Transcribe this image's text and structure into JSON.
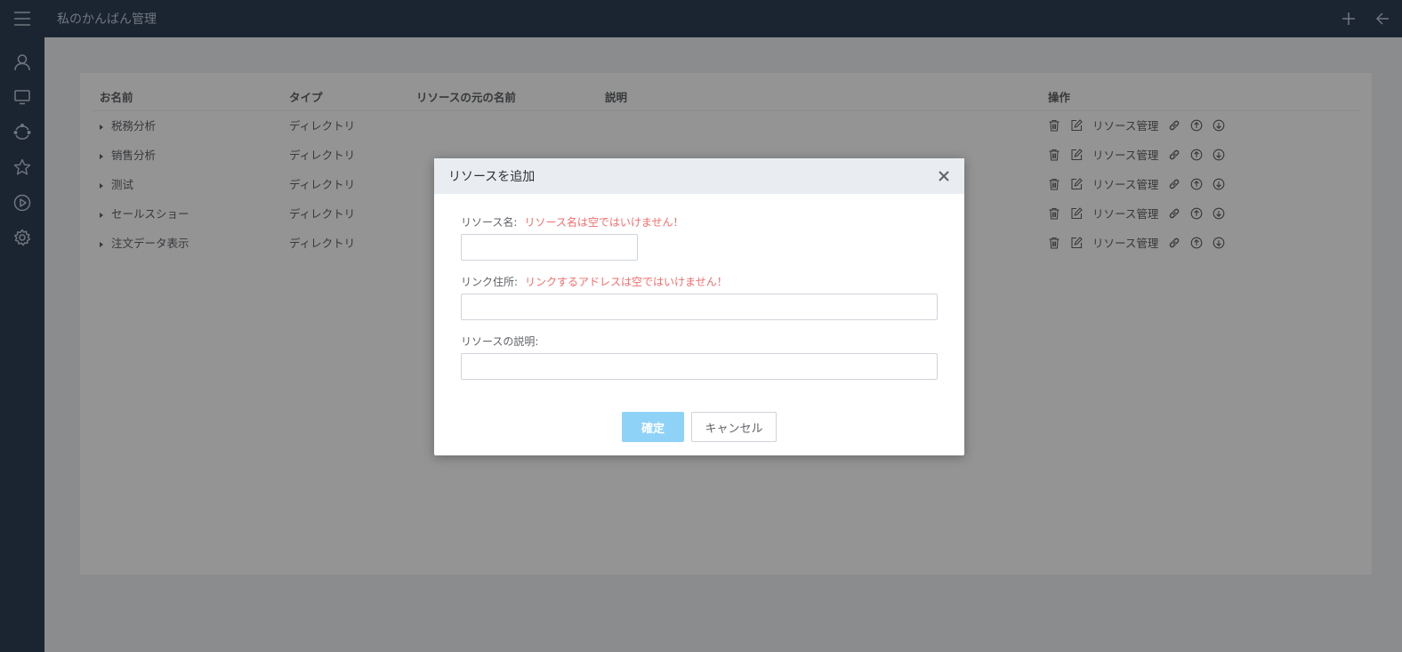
{
  "header": {
    "title": "私のかんばん管理"
  },
  "colors": {
    "sidebar_bg": "#304156",
    "error": "#f56c6c",
    "primary_disabled": "#8fd2f7"
  },
  "sidebar": {
    "icons": [
      "user-icon",
      "monitor-icon",
      "refresh-icon",
      "star-icon",
      "play-icon",
      "settings-icon"
    ]
  },
  "table": {
    "columns": [
      "お名前",
      "タイプ",
      "リソースの元の名前",
      "説明",
      "操作"
    ],
    "rows": [
      {
        "name": "税務分析",
        "type": "ディレクトリ",
        "source": "",
        "desc": "",
        "manage": "リソース管理"
      },
      {
        "name": "销售分析",
        "type": "ディレクトリ",
        "source": "",
        "desc": "",
        "manage": "リソース管理"
      },
      {
        "name": "测试",
        "type": "ディレクトリ",
        "source": "",
        "desc": "",
        "manage": "リソース管理"
      },
      {
        "name": "セールスショー",
        "type": "ディレクトリ",
        "source": "",
        "desc": "",
        "manage": "リソース管理"
      },
      {
        "name": "注文データ表示",
        "type": "ディレクトリ",
        "source": "",
        "desc": "",
        "manage": "リソース管理"
      }
    ]
  },
  "dialog": {
    "title": "リソースを追加",
    "fields": {
      "name": {
        "label": "リソース名:",
        "error": "リソース名は空ではいけません！",
        "value": "",
        "placeholder": ""
      },
      "link": {
        "label": "リンク住所:",
        "error": "リンクするアドレスは空ではいけません！",
        "value": "",
        "placeholder": ""
      },
      "description": {
        "label": "リソースの説明:",
        "error": "",
        "value": "",
        "placeholder": ""
      }
    },
    "confirm_label": "確定",
    "cancel_label": "キャンセル"
  }
}
